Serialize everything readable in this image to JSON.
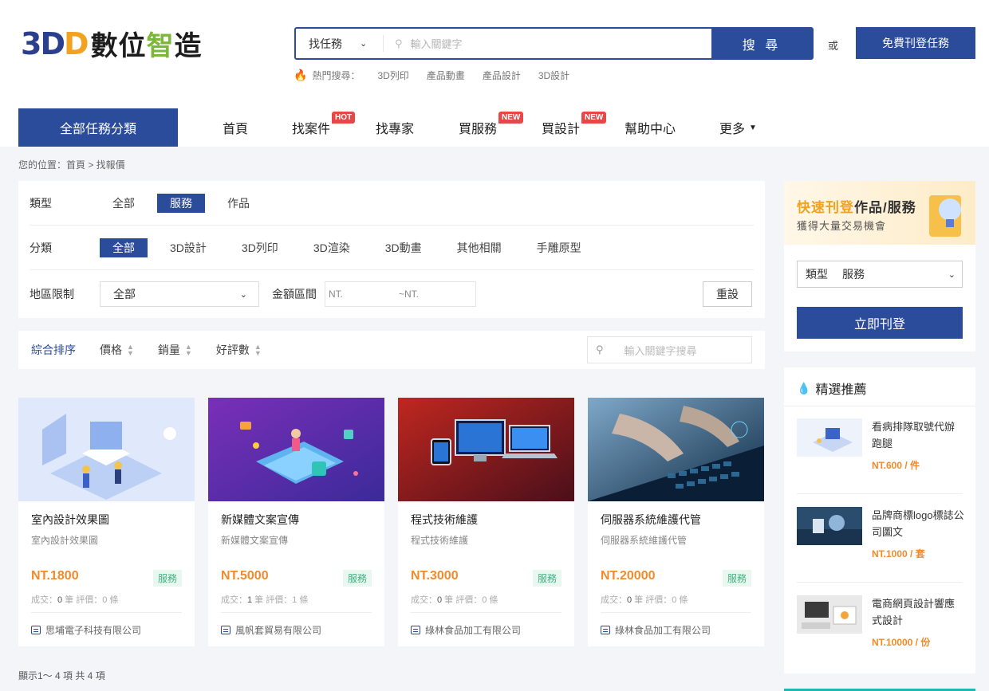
{
  "header": {
    "logo_mark": "3DD",
    "logo_text_a": "數位",
    "logo_text_b": "智",
    "logo_text_c": "造",
    "search_scope": "找任務",
    "search_placeholder": "輸入關鍵字",
    "search_button": "搜 尋",
    "or_text": "或",
    "post_button": "免費刊登任務",
    "hot_label": "熱門搜尋：",
    "hot_keywords": [
      "3D列印",
      "產品動畫",
      "產品設計",
      "3D設計"
    ]
  },
  "nav": {
    "all_categories": "全部任務分類",
    "items": [
      {
        "label": "首頁",
        "badge": ""
      },
      {
        "label": "找案件",
        "badge": "HOT"
      },
      {
        "label": "找專家",
        "badge": ""
      },
      {
        "label": "買服務",
        "badge": "NEW"
      },
      {
        "label": "買設計",
        "badge": "NEW"
      },
      {
        "label": "幫助中心",
        "badge": ""
      },
      {
        "label": "更多",
        "badge": ""
      }
    ]
  },
  "breadcrumb": "您的位置：首頁 > 找報價",
  "filters": {
    "type_label": "類型",
    "type_options": [
      "全部",
      "服務",
      "作品"
    ],
    "type_selected": "服務",
    "category_label": "分類",
    "category_options": [
      "全部",
      "3D設計",
      "3D列印",
      "3D渲染",
      "3D動畫",
      "其他相關",
      "手雕原型"
    ],
    "category_selected": "全部",
    "region_label": "地區限制",
    "region_value": "全部",
    "amount_label": "金額區間",
    "amount_from_placeholder": "NT.",
    "amount_to_placeholder": "~NT.",
    "reset_button": "重設"
  },
  "sort": {
    "items": [
      "綜合排序",
      "價格",
      "銷量",
      "好評數"
    ],
    "search_placeholder": "輸入關鍵字搜尋"
  },
  "cards": [
    {
      "title": "室內設計效果圖",
      "subtitle": "室內設計效果圖",
      "price": "NT.1800",
      "tag": "服務",
      "deals": "0",
      "reviews": "0",
      "company": "思埔電子科技有限公司"
    },
    {
      "title": "新媒體文案宣傳",
      "subtitle": "新媒體文案宣傳",
      "price": "NT.5000",
      "tag": "服務",
      "deals": "1",
      "reviews": "1",
      "company": "風帆套貿易有限公司"
    },
    {
      "title": "程式技術維護",
      "subtitle": "程式技術維護",
      "price": "NT.3000",
      "tag": "服務",
      "deals": "0",
      "reviews": "0",
      "company": "綠林食品加工有限公司"
    },
    {
      "title": "伺服器系統維護代管",
      "subtitle": "伺服器系統維護代管",
      "price": "NT.20000",
      "tag": "服務",
      "deals": "0",
      "reviews": "0",
      "company": "綠林食品加工有限公司"
    }
  ],
  "card_labels": {
    "deals_prefix": "成交：",
    "deals_unit": " 筆 評價：",
    "reviews_unit": " 條"
  },
  "pager_info": "顯示1～ 4 項 共 4 項",
  "sidebar": {
    "banner_title_a": "快速刊登",
    "banner_title_b": "作品/服務",
    "banner_subtitle": "獲得大量交易機會",
    "select_label": "類型",
    "select_value": "服務",
    "post_button": "立即刊登",
    "rec_title": "精選推薦",
    "rec_items": [
      {
        "title": "看病排隊取號代辦跑腿",
        "price": "NT.600 / 件"
      },
      {
        "title": "品牌商標logo標誌公司圖文",
        "price": "NT.1000 / 套"
      },
      {
        "title": "電商網頁設計響應式設計",
        "price": "NT.10000 / 份"
      }
    ]
  },
  "colors": {
    "primary": "#2b4b9b",
    "price": "#f28a2a",
    "tag": "#3fb27f",
    "badge": "#e84747",
    "accent": "#f3a21f"
  }
}
